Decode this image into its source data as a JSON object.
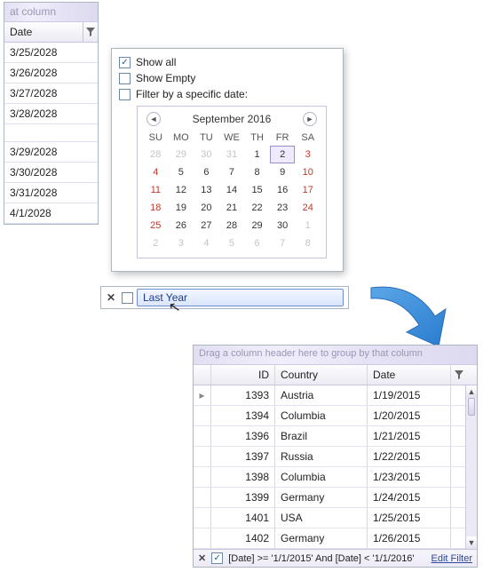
{
  "top_header": {
    "text": "at column"
  },
  "date_list": {
    "column_label": "Date",
    "rows": [
      "3/25/2028",
      "3/26/2028",
      "3/27/2028",
      "3/28/2028",
      "",
      "3/29/2028",
      "3/30/2028",
      "3/31/2028",
      "4/1/2028"
    ]
  },
  "filter_popup": {
    "show_all_label": "Show all",
    "show_empty_label": "Show Empty",
    "filter_by_date_label": "Filter by a specific date:"
  },
  "calendar": {
    "title": "September 2016",
    "dow": [
      "SU",
      "MO",
      "TU",
      "WE",
      "TH",
      "FR",
      "SA"
    ],
    "weeks": [
      [
        {
          "d": "28",
          "inactive": true
        },
        {
          "d": "29",
          "inactive": true
        },
        {
          "d": "30",
          "inactive": true
        },
        {
          "d": "31",
          "inactive": true
        },
        {
          "d": "1"
        },
        {
          "d": "2",
          "selected": true
        },
        {
          "d": "3",
          "weekend": true
        }
      ],
      [
        {
          "d": "4",
          "weekend": true
        },
        {
          "d": "5"
        },
        {
          "d": "6"
        },
        {
          "d": "7"
        },
        {
          "d": "8"
        },
        {
          "d": "9"
        },
        {
          "d": "10",
          "weekend": true
        }
      ],
      [
        {
          "d": "11",
          "weekend": true
        },
        {
          "d": "12"
        },
        {
          "d": "13"
        },
        {
          "d": "14"
        },
        {
          "d": "15"
        },
        {
          "d": "16"
        },
        {
          "d": "17",
          "weekend": true
        }
      ],
      [
        {
          "d": "18",
          "weekend": true
        },
        {
          "d": "19"
        },
        {
          "d": "20"
        },
        {
          "d": "21"
        },
        {
          "d": "22"
        },
        {
          "d": "23"
        },
        {
          "d": "24",
          "weekend": true
        }
      ],
      [
        {
          "d": "25",
          "weekend": true
        },
        {
          "d": "26"
        },
        {
          "d": "27"
        },
        {
          "d": "28"
        },
        {
          "d": "29"
        },
        {
          "d": "30"
        },
        {
          "d": "1",
          "inactive": true
        }
      ],
      [
        {
          "d": "2",
          "inactive": true
        },
        {
          "d": "3",
          "inactive": true
        },
        {
          "d": "4",
          "inactive": true
        },
        {
          "d": "5",
          "inactive": true
        },
        {
          "d": "6",
          "inactive": true
        },
        {
          "d": "7",
          "inactive": true
        },
        {
          "d": "8",
          "inactive": true
        }
      ]
    ]
  },
  "filter_bar": {
    "last_year_label": "Last Year"
  },
  "result_grid": {
    "group_hint": "Drag a column header here to group by that column",
    "columns": {
      "id": "ID",
      "country": "Country",
      "date": "Date"
    },
    "rows": [
      {
        "id": "1393",
        "country": "Austria",
        "date": "1/19/2015"
      },
      {
        "id": "1394",
        "country": "Columbia",
        "date": "1/20/2015"
      },
      {
        "id": "1396",
        "country": "Brazil",
        "date": "1/21/2015"
      },
      {
        "id": "1397",
        "country": "Russia",
        "date": "1/22/2015"
      },
      {
        "id": "1398",
        "country": "Columbia",
        "date": "1/23/2015"
      },
      {
        "id": "1399",
        "country": "Germany",
        "date": "1/24/2015"
      },
      {
        "id": "1401",
        "country": "USA",
        "date": "1/25/2015"
      },
      {
        "id": "1402",
        "country": "Germany",
        "date": "1/26/2015"
      }
    ],
    "footer_expr": "[Date] >= '1/1/2015' And [Date] < '1/1/2016'",
    "edit_filter_label": "Edit Filter"
  }
}
